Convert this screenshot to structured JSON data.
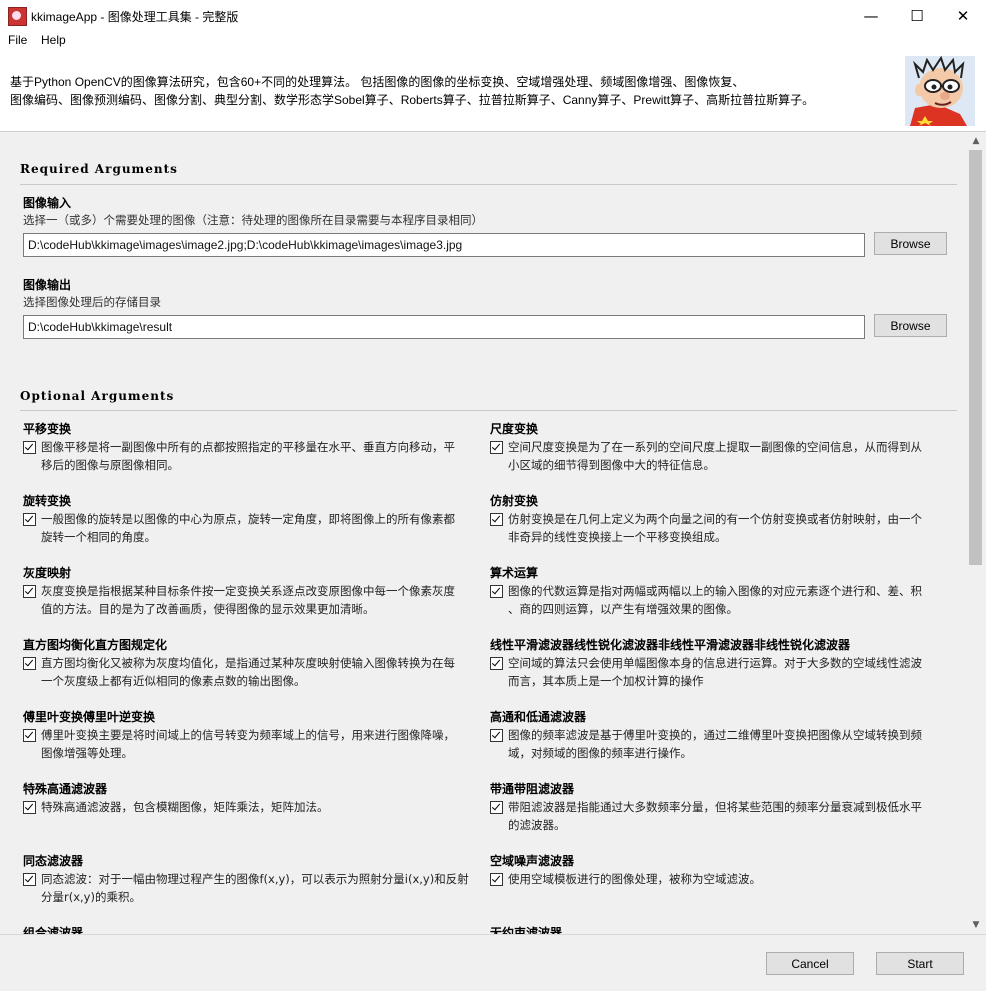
{
  "window": {
    "title": "kkimageApp - 图像处理工具集 - 完整版",
    "minimize": "—",
    "maximize": "☐",
    "close": "✕"
  },
  "menu": {
    "file": "File",
    "help": "Help"
  },
  "header": {
    "line1": "基于Python OpenCV的图像算法研究，包含60+不同的处理算法。 包括图像的图像的坐标变换、空域增强处理、频域图像增强、图像恢复、",
    "line2": "图像编码、图像预测编码、图像分割、典型分割、数学形态学Sobel算子、Roberts算子、拉普拉斯算子、Canny算子、Prewitt算子、高斯拉普拉斯算子。"
  },
  "required": {
    "title": "Required Arguments",
    "input": {
      "label": "图像输入",
      "help": "选择一（或多）个需要处理的图像（注意：待处理的图像所在目录需要与本程序目录相同）",
      "value": "D:\\codeHub\\kkimage\\images\\image2.jpg;D:\\codeHub\\kkimage\\images\\image3.jpg",
      "browse": "Browse"
    },
    "output": {
      "label": "图像输出",
      "help": "选择图像处理后的存储目录",
      "value": "D:\\codeHub\\kkimage\\result",
      "browse": "Browse"
    }
  },
  "optional": {
    "title": "Optional Arguments",
    "left": [
      {
        "title": "平移变换",
        "checked": true,
        "line1": "图像平移是将一副图像中所有的点都按照指定的平移量在水平、垂直方向移动，平",
        "line2": "移后的图像与原图像相同。"
      },
      {
        "title": "旋转变换",
        "checked": true,
        "line1": "一般图像的旋转是以图像的中心为原点，旋转一定角度，即将图像上的所有像素都",
        "line2": "旋转一个相同的角度。"
      },
      {
        "title": "灰度映射",
        "checked": true,
        "line1": "灰度变换是指根据某种目标条件按一定变换关系逐点改变原图像中每一个像素灰度",
        "line2": "值的方法。目的是为了改善画质，使得图像的显示效果更加清晰。"
      },
      {
        "title": "直方图均衡化直方图规定化",
        "checked": true,
        "line1": "直方图均衡化又被称为灰度均值化，是指通过某种灰度映射使输入图像转换为在每",
        "line2": "一个灰度级上都有近似相同的像素点数的输出图像。"
      },
      {
        "title": "傅里叶变换傅里叶逆变换",
        "checked": true,
        "line1": "傅里叶变换主要是将时间域上的信号转变为频率域上的信号，用来进行图像降噪，",
        "line2": "图像增强等处理。"
      },
      {
        "title": "特殊高通滤波器",
        "checked": true,
        "line1": "特殊高通滤波器，包含模糊图像，矩阵乘法，矩阵加法。",
        "line2": ""
      },
      {
        "title": "同态滤波器",
        "checked": true,
        "line1": "同态滤波：对于一幅由物理过程产生的图像f(x,y)，可以表示为照射分量i(x,y)和反射",
        "line2": "分量r(x,y)的乘积。"
      },
      {
        "title": "组合滤波器",
        "checked": true,
        "line1": "",
        "line2": ""
      }
    ],
    "right": [
      {
        "title": "尺度变换",
        "checked": true,
        "line1": "空间尺度变换是为了在一系列的空间尺度上提取一副图像的空间信息，从而得到从",
        "line2": "小区域的细节得到图像中大的特征信息。"
      },
      {
        "title": "仿射变换",
        "checked": true,
        "line1": "仿射变换是在几何上定义为两个向量之间的有一个仿射变换或者仿射映射，由一个",
        "line2": "非奇异的线性变换接上一个平移变换组成。"
      },
      {
        "title": "算术运算",
        "checked": true,
        "line1": "图像的代数运算是指对两幅或两幅以上的输入图像的对应元素逐个进行和、差、积",
        "line2": "、商的四则运算，以产生有增强效果的图像。"
      },
      {
        "title": "线性平滑滤波器线性锐化滤波器非线性平滑滤波器非线性锐化滤波器",
        "checked": true,
        "line1": "空间域的算法只会使用单幅图像本身的信息进行运算。对于大多数的空域线性滤波",
        "line2": "而言，其本质上是一个加权计算的操作"
      },
      {
        "title": "高通和低通滤波器",
        "checked": true,
        "line1": "图像的频率滤波是基于傅里叶变换的，通过二维傅里叶变换把图像从空域转换到频",
        "line2": "域，对频域的图像的频率进行操作。"
      },
      {
        "title": "带通带阻滤波器",
        "checked": true,
        "line1": "带阻滤波器是指能通过大多数频率分量，但将某些范围的频率分量衰减到极低水平",
        "line2": "的滤波器。"
      },
      {
        "title": "空域噪声滤波器",
        "checked": true,
        "line1": "使用空域模板进行的图像处理，被称为空域滤波。",
        "line2": ""
      },
      {
        "title": "无约束滤波器",
        "checked": true,
        "line1": "",
        "line2": ""
      }
    ]
  },
  "footer": {
    "cancel": "Cancel",
    "start": "Start"
  },
  "scrollbar": {
    "up": "▲",
    "down": "▼"
  }
}
